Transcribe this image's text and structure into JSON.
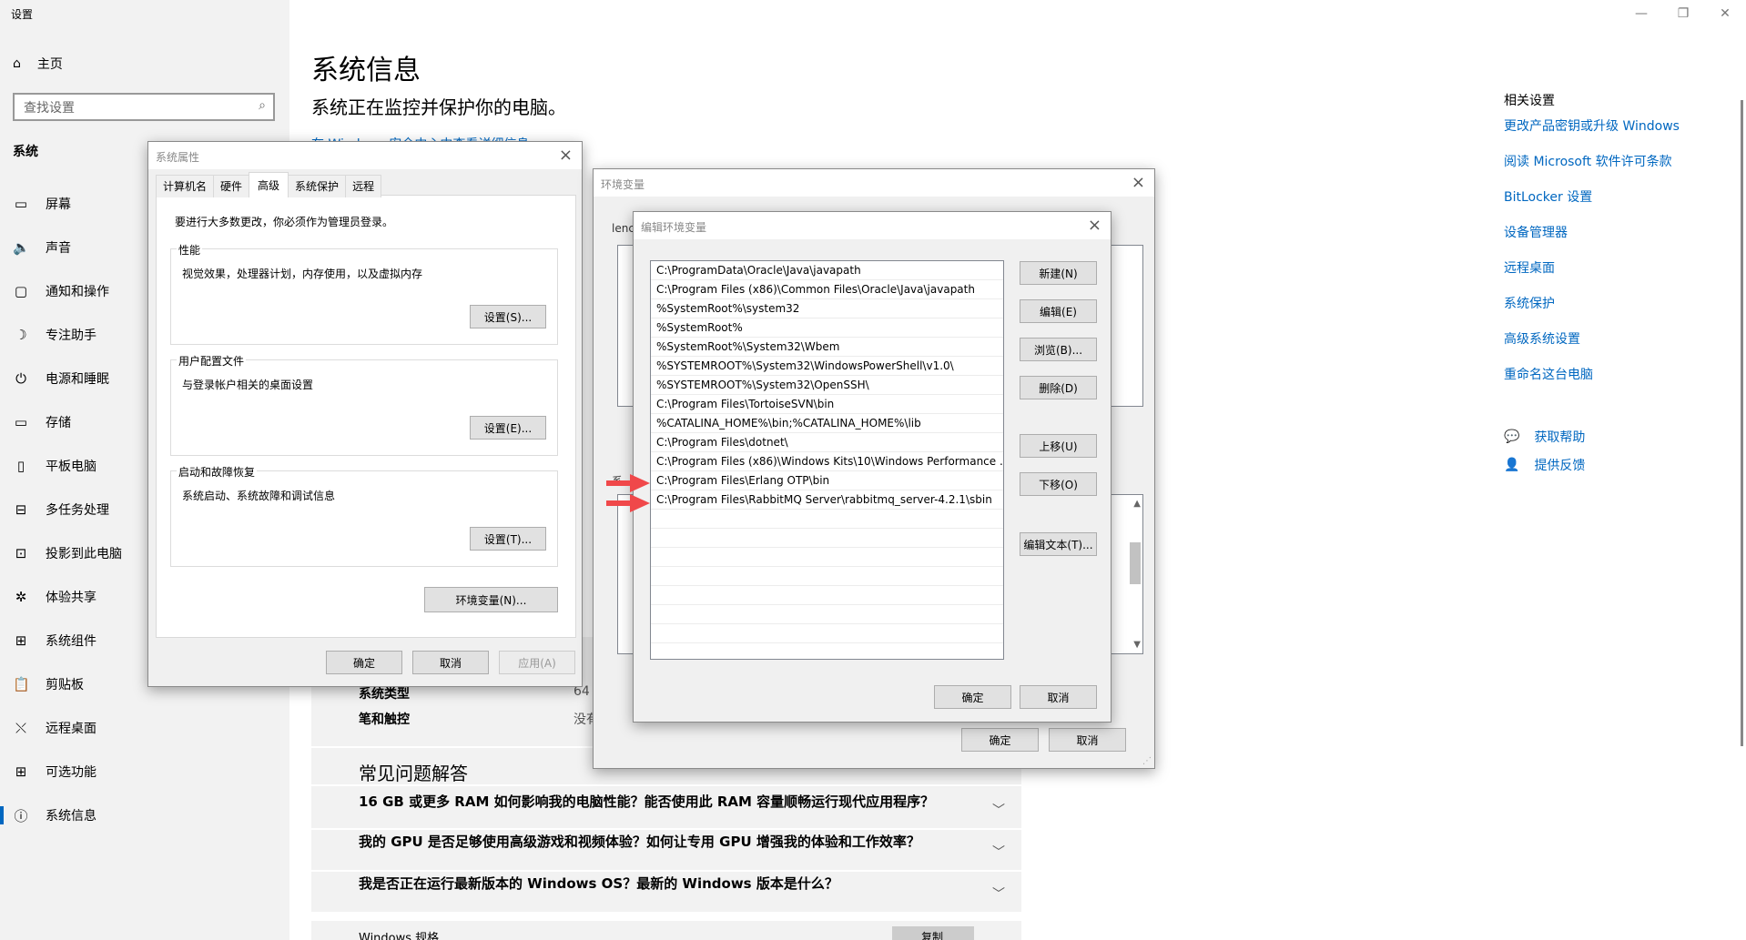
{
  "settings": {
    "title": "设置",
    "home": "主页",
    "search_placeholder": "查找设置",
    "section": "系统",
    "nav": [
      {
        "label": "屏幕",
        "icon": "display-icon"
      },
      {
        "label": "声音",
        "icon": "sound-icon"
      },
      {
        "label": "通知和操作",
        "icon": "notification-icon"
      },
      {
        "label": "专注助手",
        "icon": "moon-icon"
      },
      {
        "label": "电源和睡眠",
        "icon": "power-icon"
      },
      {
        "label": "存储",
        "icon": "storage-icon"
      },
      {
        "label": "平板电脑",
        "icon": "tablet-icon"
      },
      {
        "label": "多任务处理",
        "icon": "multitask-icon"
      },
      {
        "label": "投影到此电脑",
        "icon": "project-icon"
      },
      {
        "label": "体验共享",
        "icon": "share-icon"
      },
      {
        "label": "系统组件",
        "icon": "component-icon"
      },
      {
        "label": "剪贴板",
        "icon": "clipboard-icon"
      },
      {
        "label": "远程桌面",
        "icon": "remote-icon"
      },
      {
        "label": "可选功能",
        "icon": "features-icon"
      },
      {
        "label": "系统信息",
        "icon": "info-icon"
      }
    ],
    "page_title": "系统信息",
    "page_subtitle": "系统正在监控并保护你的电脑。",
    "top_link": "在 Windows 安全中心中查看详细信息",
    "spec_rows": [
      {
        "label": "系统类型",
        "value": "64"
      },
      {
        "label": "笔和触控",
        "value": "没有"
      }
    ],
    "faq_title": "常见问题解答",
    "faq": [
      "16 GB 或更多 RAM 如何影响我的电脑性能？能否使用此 RAM 容量顺畅运行现代应用程序？",
      "我的 GPU 是否足够使用高级游戏和视频体验？如何让专用 GPU 增强我的体验和工作效率？",
      "我是否正在运行最新版本的 Windows OS？最新的 Windows 版本是什么？"
    ],
    "bottom_label": "Windows 规格",
    "bottom_button": "复制",
    "related_title": "相关设置",
    "related_links": [
      "更改产品密钥或升级 Windows",
      "阅读 Microsoft 软件许可条款",
      "BitLocker 设置",
      "设备管理器",
      "远程桌面",
      "系统保护",
      "高级系统设置",
      "重命名这台电脑"
    ],
    "help": [
      "获取帮助",
      "提供反馈"
    ]
  },
  "sysprops": {
    "title": "系统属性",
    "tabs": [
      "计算机名",
      "硬件",
      "高级",
      "系统保护",
      "远程"
    ],
    "selected_tab": "高级",
    "admin_note": "要进行大多数更改，你必须作为管理员登录。",
    "groups": [
      {
        "label": "性能",
        "desc": "视觉效果，处理器计划，内存使用，以及虚拟内存",
        "button": "设置(S)..."
      },
      {
        "label": "用户配置文件",
        "desc": "与登录帐户相关的桌面设置",
        "button": "设置(E)..."
      },
      {
        "label": "启动和故障恢复",
        "desc": "系统启动、系统故障和调试信息",
        "button": "设置(T)..."
      }
    ],
    "env_button": "环境变量(N)...",
    "ok": "确定",
    "cancel": "取消",
    "apply": "应用(A)"
  },
  "envvars": {
    "title": "环境变量",
    "user_label_partial": "lenc",
    "sys_label_partial": "系",
    "ok": "确定",
    "cancel": "取消"
  },
  "editenv": {
    "title": "编辑环境变量",
    "paths": [
      "C:\\ProgramData\\Oracle\\Java\\javapath",
      "C:\\Program Files (x86)\\Common Files\\Oracle\\Java\\javapath",
      "%SystemRoot%\\system32",
      "%SystemRoot%",
      "%SystemRoot%\\System32\\Wbem",
      "%SYSTEMROOT%\\System32\\WindowsPowerShell\\v1.0\\",
      "%SYSTEMROOT%\\System32\\OpenSSH\\",
      "C:\\Program Files\\TortoiseSVN\\bin",
      "%CATALINA_HOME%\\bin;%CATALINA_HOME%\\lib",
      "C:\\Program Files\\dotnet\\",
      "C:\\Program Files (x86)\\Windows Kits\\10\\Windows Performance ...",
      "C:\\Program Files\\Erlang OTP\\bin",
      "C:\\Program Files\\RabbitMQ Server\\rabbitmq_server-4.2.1\\sbin"
    ],
    "buttons": [
      "新建(N)",
      "编辑(E)",
      "浏览(B)...",
      "删除(D)",
      "上移(U)",
      "下移(O)",
      "编辑文本(T)..."
    ],
    "ok": "确定",
    "cancel": "取消"
  }
}
